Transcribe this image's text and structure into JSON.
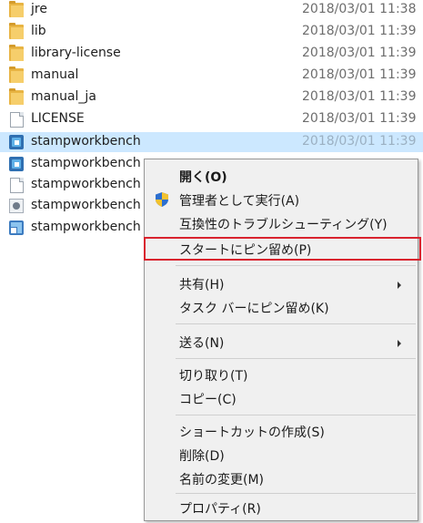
{
  "files": [
    {
      "name": "jre",
      "date": "2018/03/01 11:38",
      "icon": "folder-icon"
    },
    {
      "name": "lib",
      "date": "2018/03/01 11:39",
      "icon": "folder-icon"
    },
    {
      "name": "library-license",
      "date": "2018/03/01 11:39",
      "icon": "folder-icon"
    },
    {
      "name": "manual",
      "date": "2018/03/01 11:39",
      "icon": "folder-icon"
    },
    {
      "name": "manual_ja",
      "date": "2018/03/01 11:39",
      "icon": "folder-icon"
    },
    {
      "name": "LICENSE",
      "date": "2018/03/01 11:39",
      "icon": "document-icon"
    },
    {
      "name": "stampworkbench",
      "date": "2018/03/01 11:39",
      "icon": "app-icon",
      "selected": true
    },
    {
      "name": "stampworkbench",
      "icon": "app-icon"
    },
    {
      "name": "stampworkbench",
      "icon": "document-icon"
    },
    {
      "name": "stampworkbench",
      "icon": "settings-icon"
    },
    {
      "name": "stampworkbench",
      "icon": "shortcut-icon"
    }
  ],
  "context_menu": {
    "open": "開く(O)",
    "run_as_admin": "管理者として実行(A)",
    "troubleshoot_compat": "互換性のトラブルシューティング(Y)",
    "pin_to_start": "スタートにピン留め(P)",
    "share": "共有(H)",
    "pin_to_taskbar": "タスク バーにピン留め(K)",
    "send_to": "送る(N)",
    "cut": "切り取り(T)",
    "copy": "コピー(C)",
    "create_shortcut": "ショートカットの作成(S)",
    "delete": "削除(D)",
    "rename": "名前の変更(M)",
    "properties": "プロパティ(R)"
  },
  "colors": {
    "selection": "#cce8ff",
    "highlight_border": "#d9232e",
    "menu_background": "#f0f0f0"
  }
}
